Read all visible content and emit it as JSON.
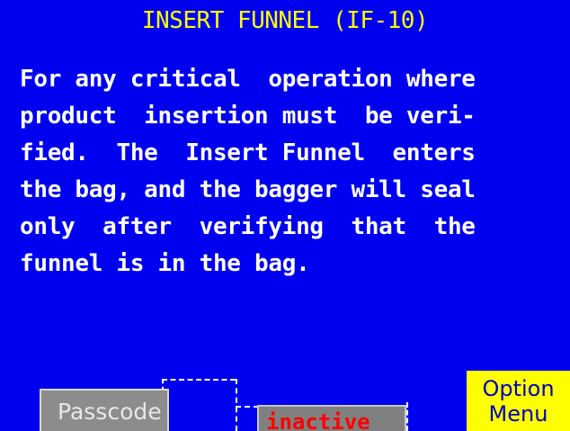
{
  "screen": {
    "title": "INSERT FUNNEL (IF-10)",
    "description_lines": [
      "For any critical  operation where",
      "product  insertion must  be veri-",
      "fied.  The  Insert Funnel  enters",
      "the bag, and the bagger will seal",
      "only  after  verifying  that  the",
      "funnel is in the bag."
    ]
  },
  "buttons": {
    "passcode_label": "Passcode",
    "option_menu_line1": "Option",
    "option_menu_line2": "Menu"
  },
  "status": {
    "label": "inactive"
  },
  "colors": {
    "background": "#0000f0",
    "title": "#ffff00",
    "body_text": "#ffffff",
    "status_text": "#ff0000",
    "option_button": "#ffff00",
    "passcode_button": "#8c8c8c"
  }
}
